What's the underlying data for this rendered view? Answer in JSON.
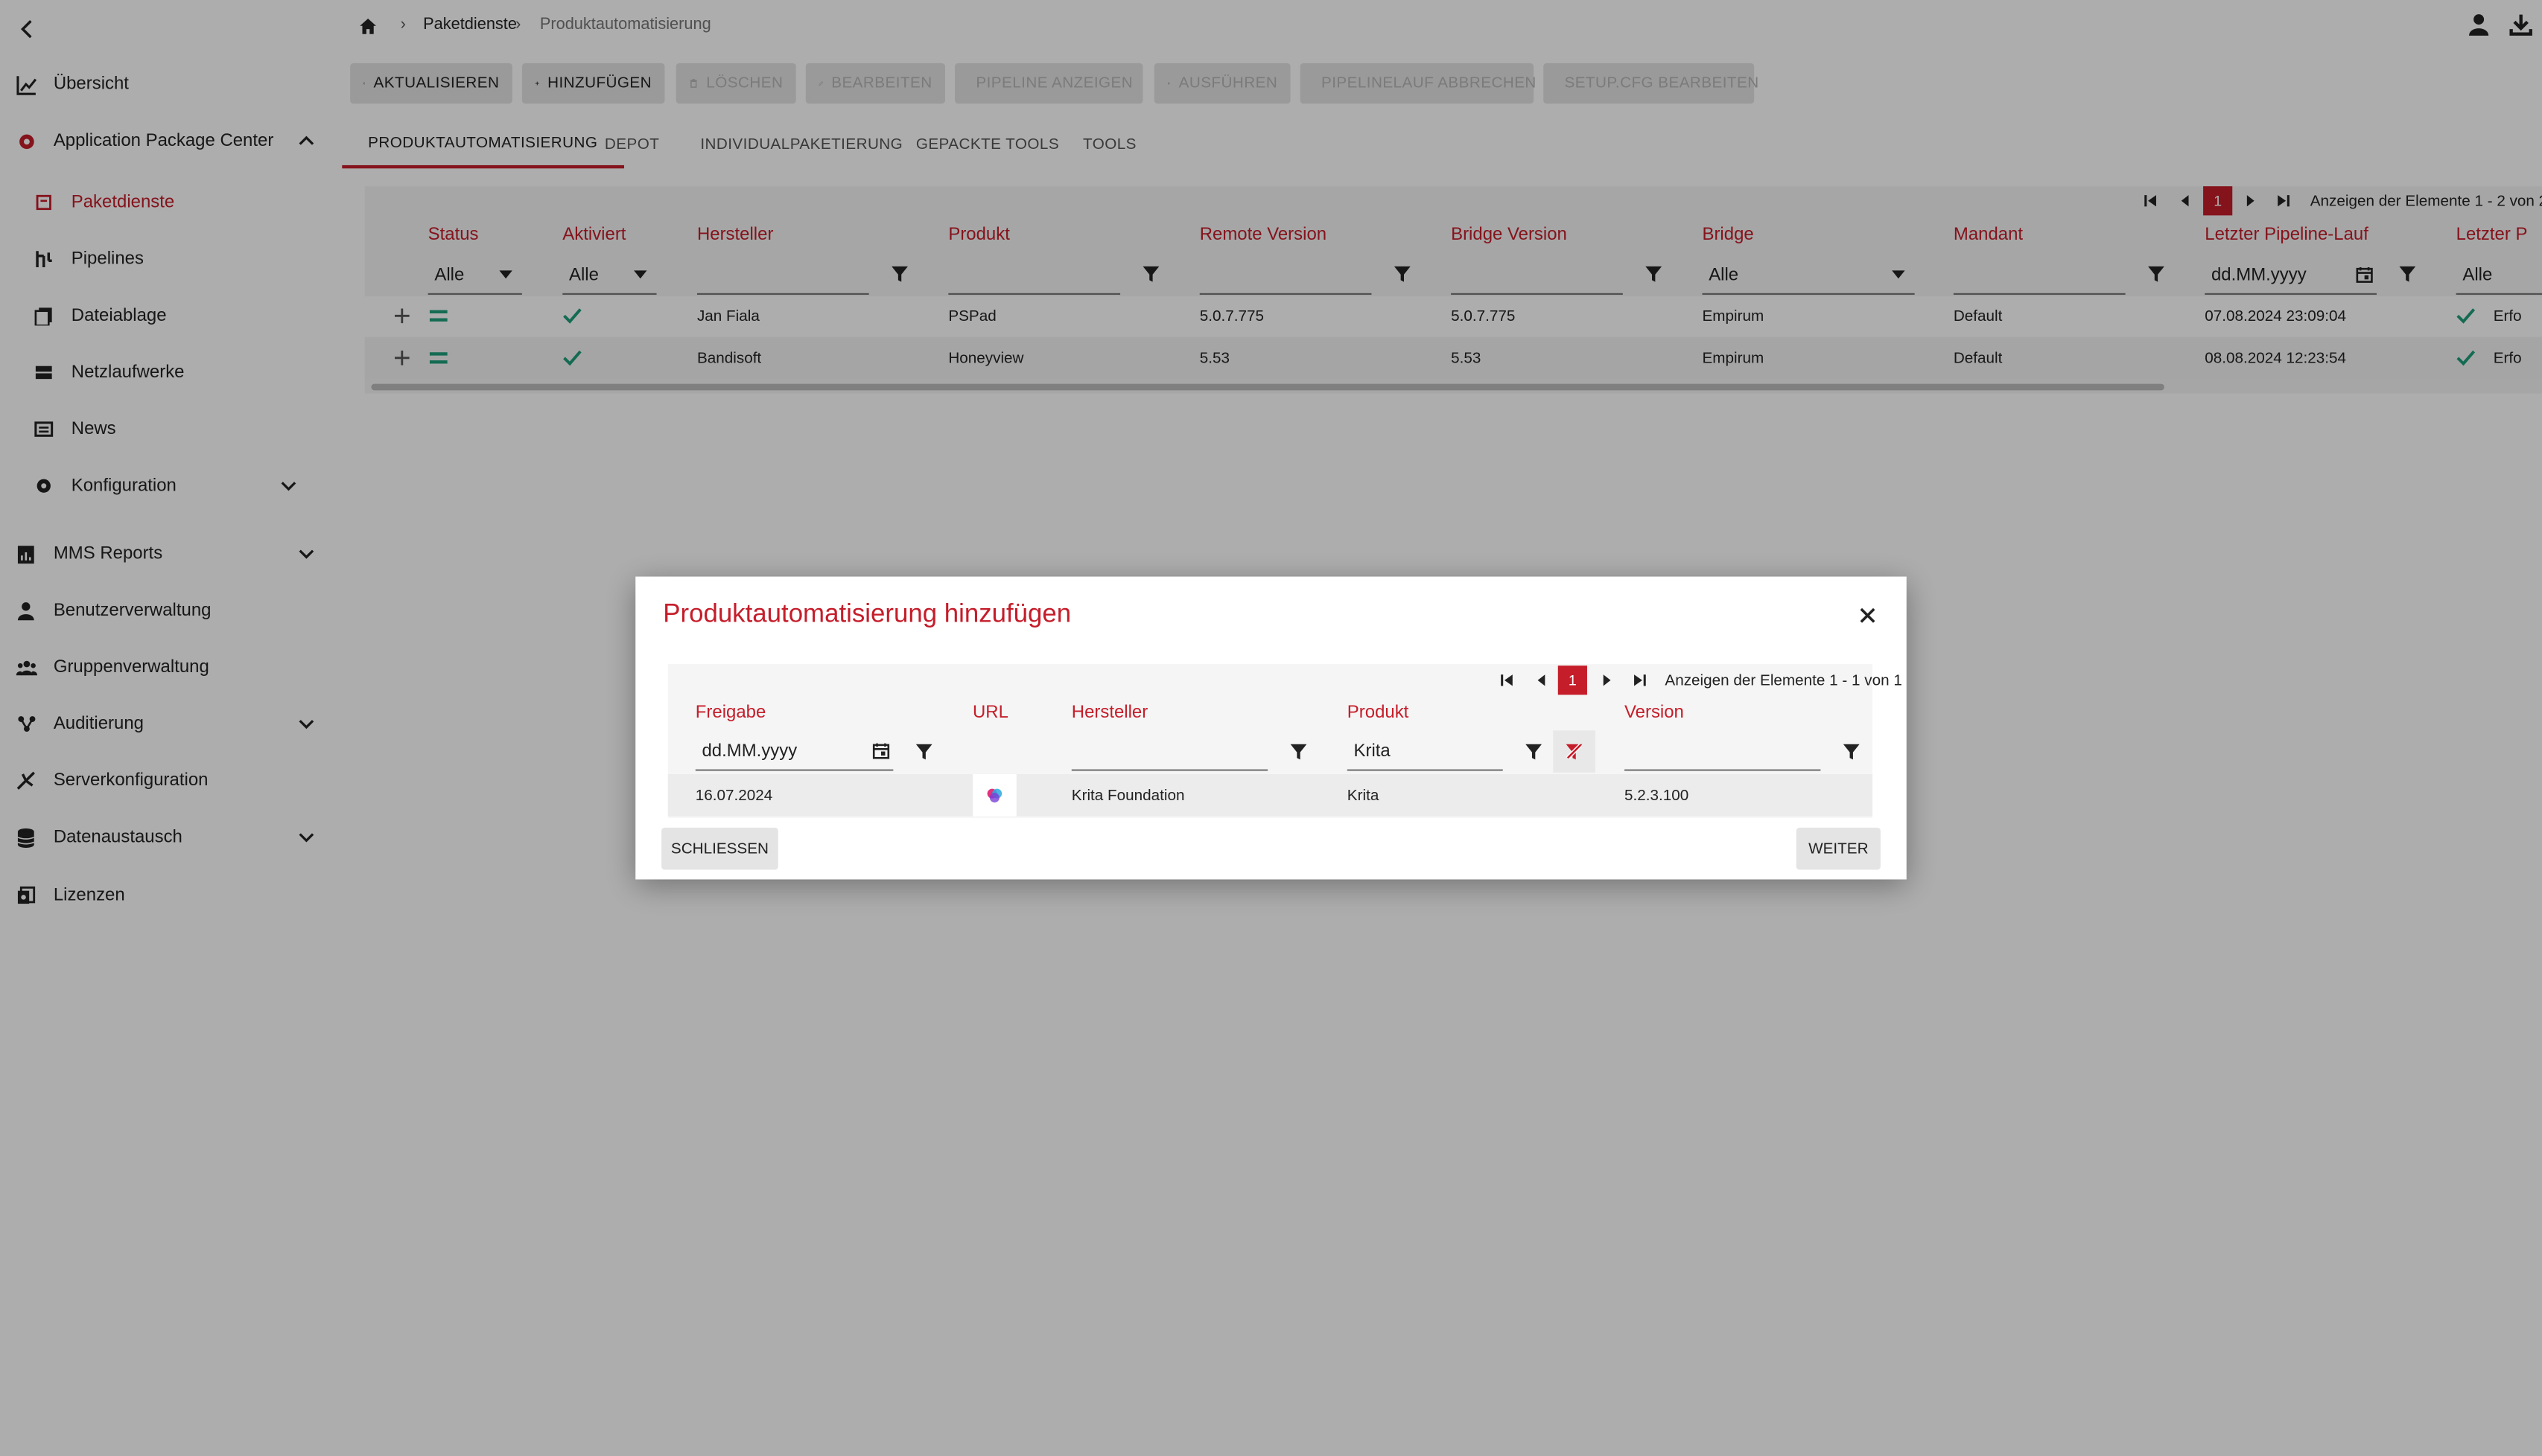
{
  "breadcrumb": {
    "level1": "Paketdienste",
    "level2": "Produktautomatisierung"
  },
  "sidebar": {
    "items": [
      {
        "label": "Übersicht"
      },
      {
        "label": "Application Package Center"
      },
      {
        "label": "Paketdienste"
      },
      {
        "label": "Pipelines"
      },
      {
        "label": "Dateiablage"
      },
      {
        "label": "Netzlaufwerke"
      },
      {
        "label": "News"
      },
      {
        "label": "Konfiguration"
      },
      {
        "label": "MMS Reports"
      },
      {
        "label": "Benutzerverwaltung"
      },
      {
        "label": "Gruppenverwaltung"
      },
      {
        "label": "Auditierung"
      },
      {
        "label": "Serverkonfiguration"
      },
      {
        "label": "Datenaustausch"
      },
      {
        "label": "Lizenzen"
      }
    ]
  },
  "toolbar": {
    "refresh": "AKTUALISIEREN",
    "add": "HINZUFÜGEN",
    "delete": "LÖSCHEN",
    "edit": "BEARBEITEN",
    "show_pipeline": "PIPELINE ANZEIGEN",
    "run": "AUSFÜHREN",
    "cancel_run": "PIPELINELAUF ABBRECHEN",
    "edit_setupcfg": "SETUP.CFG BEARBEITEN"
  },
  "tabs": [
    "PRODUKTAUTOMATISIERUNG",
    "DEPOT",
    "INDIVIDUALPAKETIERUNG",
    "GEPACKTE TOOLS",
    "TOOLS"
  ],
  "grid": {
    "page": "1",
    "paging_text": "Anzeigen der Elemente 1 - 2 von 2",
    "columns": [
      "Status",
      "Aktiviert",
      "Hersteller",
      "Produkt",
      "Remote Version",
      "Bridge Version",
      "Bridge",
      "Mandant",
      "Letzter Pipeline-Lauf",
      "Letzter P"
    ],
    "filters": {
      "status": "Alle",
      "aktiviert": "Alle",
      "bridge": "Alle",
      "letzter_lauf": "dd.MM.yyyy",
      "letzter_p": "Alle"
    },
    "rows": [
      {
        "hersteller": "Jan Fiala",
        "produkt": "PSPad",
        "remote": "5.0.7.775",
        "bridge_version": "5.0.7.775",
        "bridge": "Empirum",
        "mandant": "Default",
        "letzter_lauf": "07.08.2024 23:09:04",
        "ergebnis": "Erfo"
      },
      {
        "hersteller": "Bandisoft",
        "produkt": "Honeyview",
        "remote": "5.53",
        "bridge_version": "5.53",
        "bridge": "Empirum",
        "mandant": "Default",
        "letzter_lauf": "08.08.2024 12:23:54",
        "ergebnis": "Erfo"
      }
    ]
  },
  "dialog": {
    "title": "Produktautomatisierung hinzufügen",
    "page": "1",
    "paging_text": "Anzeigen der Elemente 1 - 1 von 1",
    "columns": [
      "Freigabe",
      "URL",
      "Hersteller",
      "Produkt",
      "Version"
    ],
    "filters": {
      "freigabe": "dd.MM.yyyy",
      "produkt": "Krita"
    },
    "rows": [
      {
        "freigabe": "16.07.2024",
        "hersteller": "Krita Foundation",
        "produkt": "Krita",
        "version": "5.2.3.100"
      }
    ],
    "close_label": "SCHLIESSEN",
    "next_label": "WEITER"
  },
  "colors": {
    "accent": "#c51d2a",
    "check": "#1e9e7a"
  }
}
